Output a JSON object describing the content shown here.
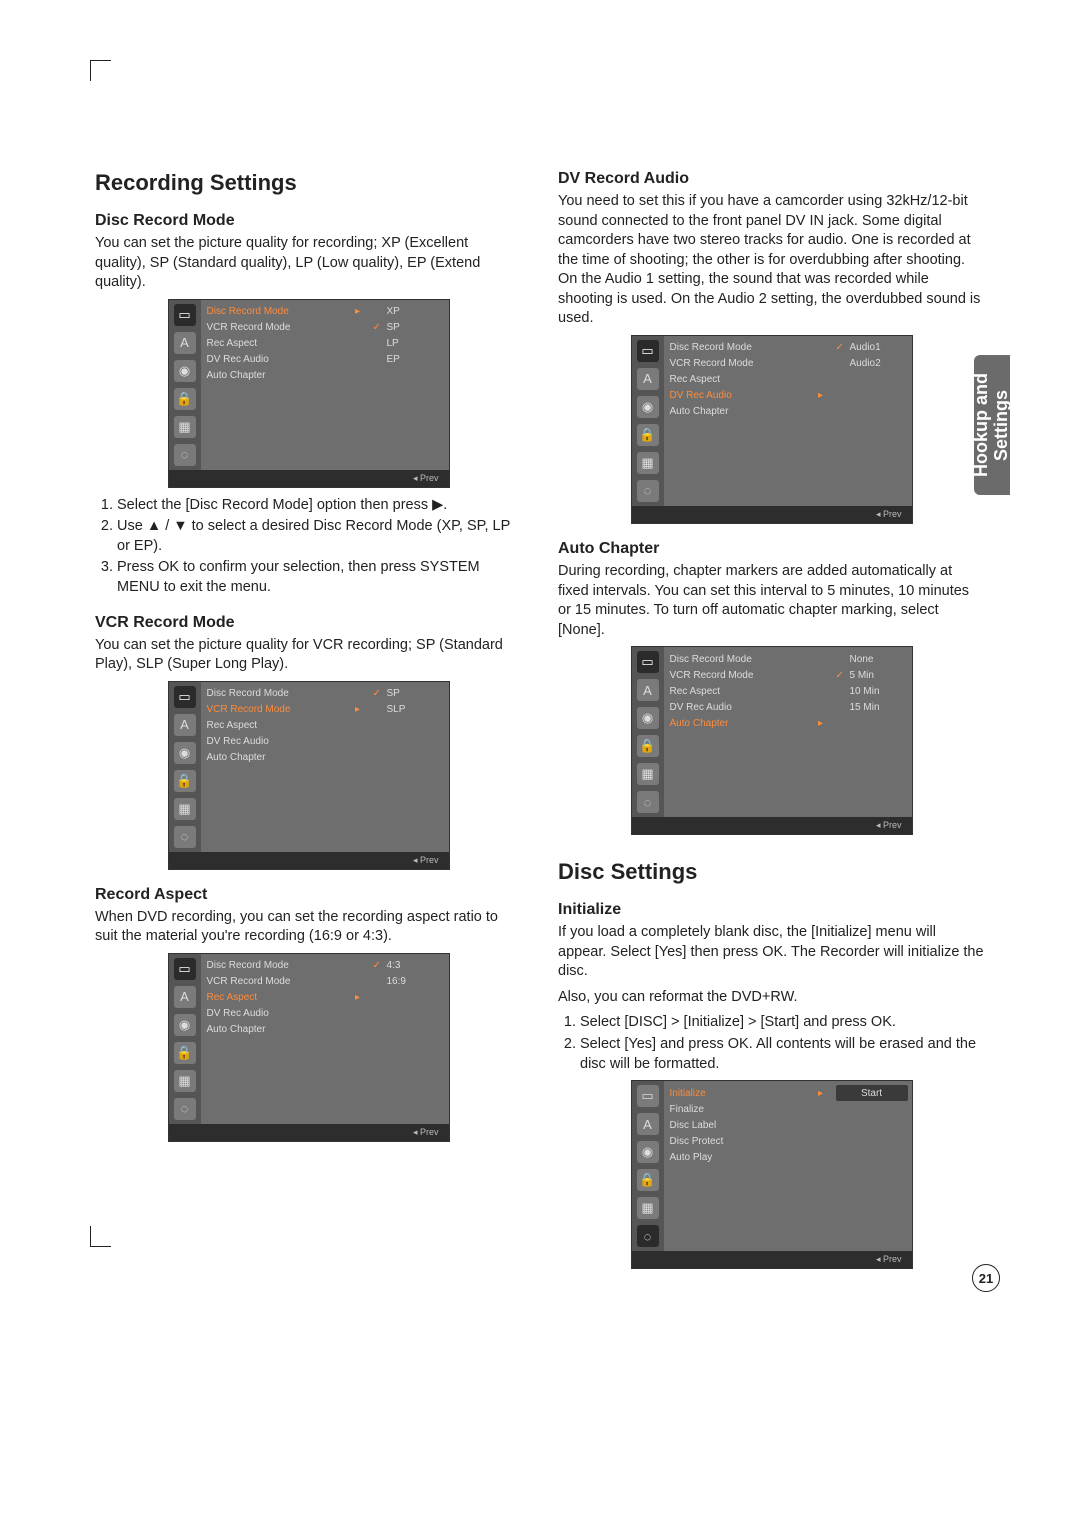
{
  "tab_label": "Hookup and\nSettings",
  "page_number": "21",
  "osd_prev": "◂ Prev",
  "recording": {
    "heading": "Recording Settings",
    "disc_mode": {
      "title": "Disc Record Mode",
      "para": "You can set the picture quality for recording; XP (Excellent quality), SP (Standard quality), LP (Low quality), EP (Extend quality).",
      "step1": "Select the [Disc Record Mode] option then press ▶.",
      "step2": "Use ▲ / ▼ to select a desired Disc Record Mode (XP, SP, LP or EP).",
      "step3": "Press OK to confirm your selection, then press SYSTEM MENU to exit the menu.",
      "menu": {
        "i1": "Disc Record Mode",
        "i2": "VCR Record Mode",
        "i3": "Rec Aspect",
        "i4": "DV Rec Audio",
        "i5": "Auto Chapter"
      },
      "opts": {
        "o1": "XP",
        "o2": "SP",
        "o3": "LP",
        "o4": "EP"
      }
    },
    "vcr_mode": {
      "title": "VCR Record Mode",
      "para": "You can set the picture quality for VCR recording; SP (Standard Play), SLP (Super Long Play).",
      "opts": {
        "o1": "SP",
        "o2": "SLP"
      }
    },
    "aspect": {
      "title": "Record Aspect",
      "para": "When DVD recording, you can set the recording aspect ratio to suit the material you're recording (16:9 or 4:3).",
      "opts": {
        "o1": "4:3",
        "o2": "16:9"
      }
    },
    "dv_audio": {
      "title": "DV Record Audio",
      "para": "You need to set this if you have a camcorder using 32kHz/12-bit sound connected to the front panel DV IN jack. Some digital camcorders have two stereo tracks for audio. One is recorded at the time of shooting; the other is for overdubbing after shooting. On the Audio 1 setting, the sound that was recorded while shooting is used. On the Audio 2 setting, the overdubbed sound is used.",
      "opts": {
        "o1": "Audio1",
        "o2": "Audio2"
      }
    },
    "auto_chapter": {
      "title": "Auto Chapter",
      "para": "During recording, chapter markers are added automatically at fixed intervals. You can set this interval to 5 minutes, 10 minutes or 15 minutes. To turn off automatic chapter marking, select [None].",
      "opts": {
        "o1": "None",
        "o2": "5 Min",
        "o3": "10 Min",
        "o4": "15 Min"
      }
    }
  },
  "disc": {
    "heading": "Disc Settings",
    "initialize": {
      "title": "Initialize",
      "para1": "If you load a completely blank disc, the [Initialize] menu will appear. Select [Yes] then press OK. The Recorder will initialize the disc.",
      "para2": "Also, you can reformat the DVD+RW.",
      "step1": "Select [DISC] > [Initialize] > [Start] and press OK.",
      "step2": "Select [Yes] and press OK. All contents will be erased and the disc will be formatted.",
      "menu": {
        "i1": "Initialize",
        "i2": "Finalize",
        "i3": "Disc Label",
        "i4": "Disc Protect",
        "i5": "Auto Play"
      },
      "opt": "Start"
    }
  }
}
